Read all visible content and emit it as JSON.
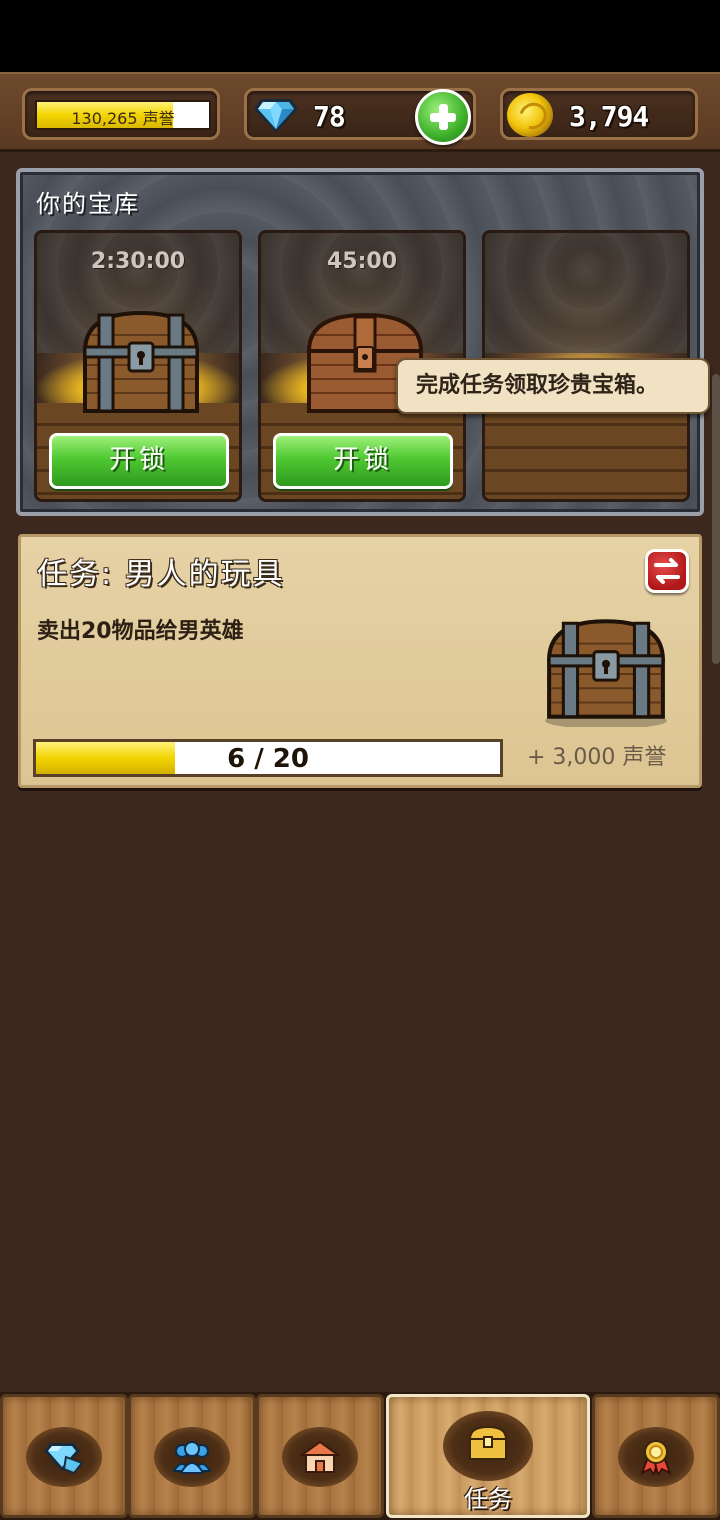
{
  "top_bar": {
    "reputation": {
      "text": "130,265 声誉",
      "progress": 0.79
    },
    "gems": "78",
    "gold": "3,794"
  },
  "vault": {
    "title": "你的宝库",
    "slots": [
      {
        "timer": "2:30:00",
        "chest": "iron-banded-chest",
        "button": "开锁"
      },
      {
        "timer": "45:00",
        "chest": "wooden-chest",
        "button": "开锁"
      },
      {
        "timer": "",
        "chest": "empty-slot",
        "button": ""
      }
    ],
    "tooltip": "完成任务领取珍贵宝箱。"
  },
  "quest": {
    "title": "任务: 男人的玩具",
    "description": "卖出20物品给男英雄",
    "progress_text": "6 / 20",
    "progress": 0.3,
    "reward": "+ 3,000 声誉"
  },
  "tabs": [
    {
      "icon": "diamond-icon",
      "label": ""
    },
    {
      "icon": "people-icon",
      "label": ""
    },
    {
      "icon": "shop-icon",
      "label": ""
    },
    {
      "icon": "chest-icon",
      "label": "任务",
      "active": true
    },
    {
      "icon": "medal-icon",
      "label": ""
    }
  ]
}
